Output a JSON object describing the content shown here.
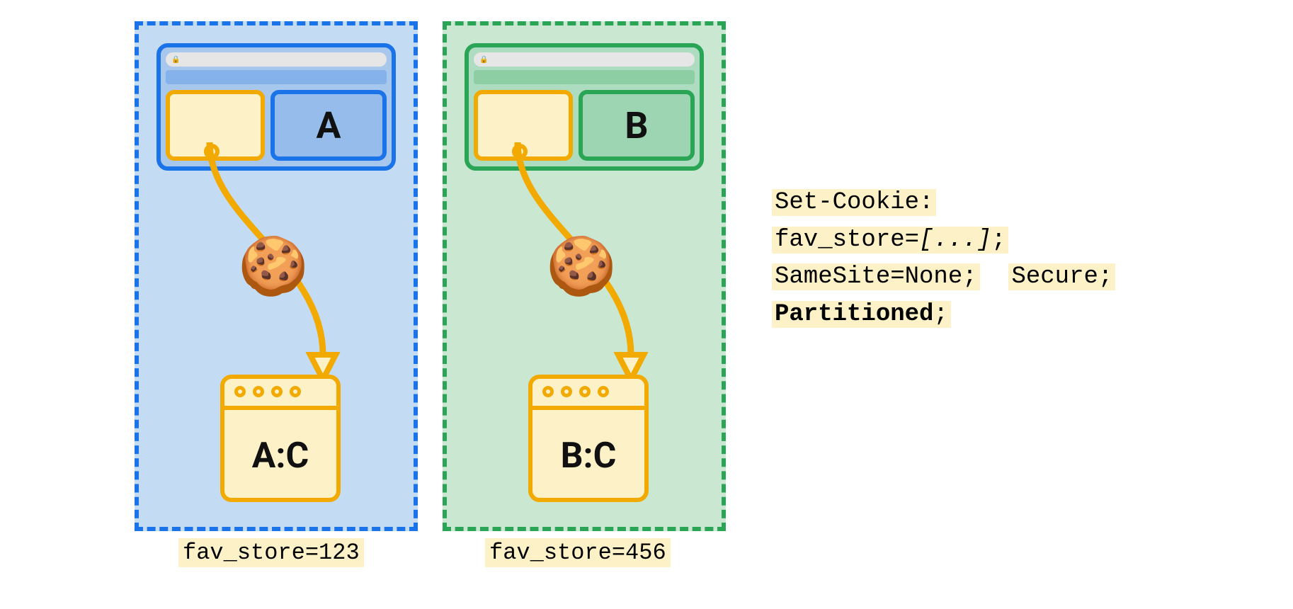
{
  "partitions": {
    "a": {
      "site_label": "A",
      "store_label": "A:C",
      "caption": "fav_store=123"
    },
    "b": {
      "site_label": "B",
      "store_label": "B:C",
      "caption": "fav_store=456"
    }
  },
  "cookie_icon": "🍪",
  "code": {
    "line1": "Set-Cookie:",
    "line2_key": "fav_store=",
    "line2_val": "[...]",
    "line2_end": ";",
    "line3_a": "SameSite=None;",
    "line3_b": "Secure;",
    "line4": "Partitioned",
    "line4_end": ";"
  }
}
